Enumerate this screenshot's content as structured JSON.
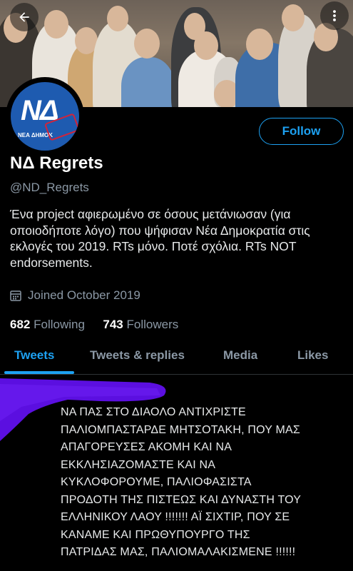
{
  "header": {
    "back_icon": "arrow-left-icon",
    "more_icon": "more-vertical-icon"
  },
  "profile": {
    "avatar_logo_text": "ΝΔ",
    "avatar_logo_subtext": "ΝΕΑ ΔΗΜΟΚ",
    "follow_label": "Follow",
    "name": "ΝΔ Regrets",
    "handle": "@ND_Regrets",
    "bio": "Ένα project αφιερωμένο σε όσους μετάνιωσαν (για οποιοδήποτε λόγο) που ψήφισαν Νέα Δημοκρατία στις εκλογές του 2019. RTs μόνο. Ποτέ σχόλια. RTs NOT endorsements.",
    "joined": "Joined October 2019",
    "following_count": "682",
    "following_label": "Following",
    "followers_count": "743",
    "followers_label": "Followers"
  },
  "tabs": [
    "Tweets",
    "Tweets & replies",
    "Media",
    "Likes"
  ],
  "active_tab": "Tweets",
  "tweet": {
    "text": "ΝΑ ΠΑΣ ΣΤΟ ΔΙΑΟΛΟ ΑΝΤΙΧΡΙΣΤΕ\nΠΑΛΙΟΜΠΑΣΤΑΡΔΕ ΜΗΤΣΟΤΑΚΗ, ΠΟΥ ΜΑΣ\nΑΠΑΓΟΡΕΥΣΕΣ ΑΚΟΜΗ ΚΑΙ ΝΑ\nΕΚΚΛΗΣΙΑΖΟΜΑΣΤΕ ΚΑΙ ΝΑ\nΚΥΚΛΟΦΟΡΟΥΜΕ, ΠΑΛΙΟΦΑΣΙΣΤΑ\nΠΡΟΔΟΤΗ ΤΗΣ ΠΙΣΤΕΩΣ ΚΑΙ ΔΥΝΑΣΤΗ ΤΟΥ\nΕΛΛΗΝΙΚΟΥ ΛΑΟΥ !!!!!!! ΑΪ ΣΙΧΤΙΡ, ΠΟΥ ΣΕ\nΚΑΝΑΜΕ ΚΑΙ ΠΡΩΘΥΠΟΥΡΓΟ ΤΗΣ\nΠΑΤΡΙΔΑΣ ΜΑΣ, ΠΑΛΙΟΜΑΛΑΚΙΣΜΕΝΕ !!!!!!"
  },
  "colors": {
    "accent": "#1da1f2",
    "background": "#000000",
    "secondary_text": "#8b98a5",
    "redaction": "#5b0fe0"
  }
}
